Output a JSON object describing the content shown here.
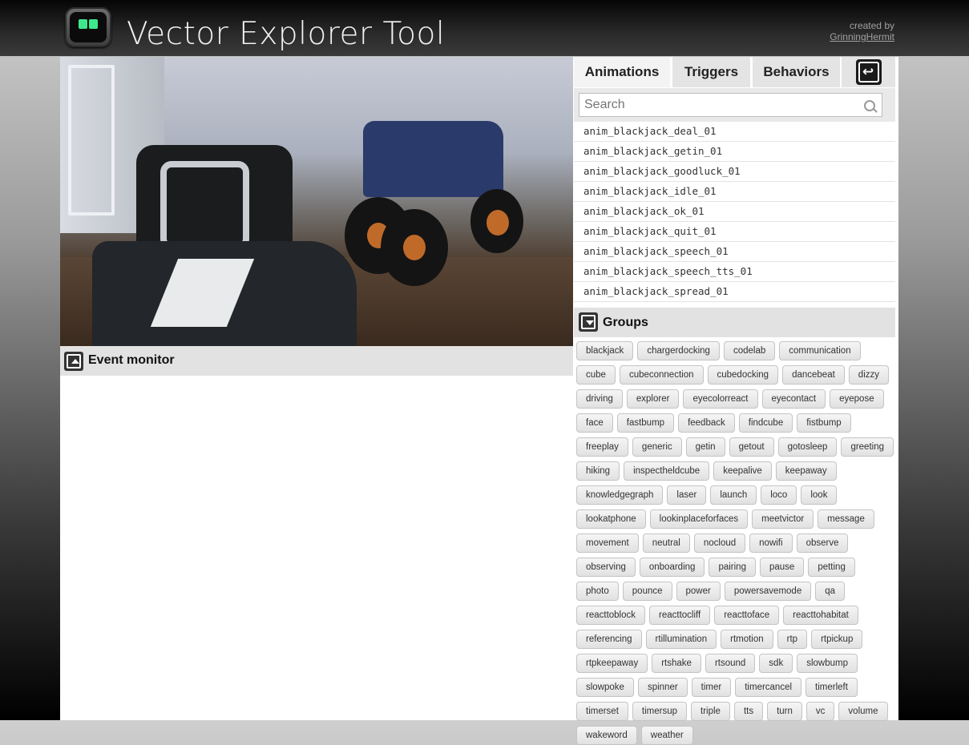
{
  "header": {
    "title": "Vector Explorer Tool",
    "created_by": "created by",
    "author": "GrinningHermit"
  },
  "event_monitor": {
    "title": "Event monitor"
  },
  "tabs": [
    {
      "label": "Animations"
    },
    {
      "label": "Triggers"
    },
    {
      "label": "Behaviors"
    }
  ],
  "search": {
    "placeholder": "Search",
    "value": ""
  },
  "animations": [
    "anim_blackjack_deal_01",
    "anim_blackjack_getin_01",
    "anim_blackjack_goodluck_01",
    "anim_blackjack_idle_01",
    "anim_blackjack_ok_01",
    "anim_blackjack_quit_01",
    "anim_blackjack_speech_01",
    "anim_blackjack_speech_tts_01",
    "anim_blackjack_spread_01"
  ],
  "groups": {
    "title": "Groups",
    "items": [
      "blackjack",
      "chargerdocking",
      "codelab",
      "communication",
      "cube",
      "cubeconnection",
      "cubedocking",
      "dancebeat",
      "dizzy",
      "driving",
      "explorer",
      "eyecolorreact",
      "eyecontact",
      "eyepose",
      "face",
      "fastbump",
      "feedback",
      "findcube",
      "fistbump",
      "freeplay",
      "generic",
      "getin",
      "getout",
      "gotosleep",
      "greeting",
      "hiking",
      "inspectheldcube",
      "keepalive",
      "keepaway",
      "knowledgegraph",
      "laser",
      "launch",
      "loco",
      "look",
      "lookatphone",
      "lookinplaceforfaces",
      "meetvictor",
      "message",
      "movement",
      "neutral",
      "nocloud",
      "nowifi",
      "observe",
      "observing",
      "onboarding",
      "pairing",
      "pause",
      "petting",
      "photo",
      "pounce",
      "power",
      "powersavemode",
      "qa",
      "reacttoblock",
      "reacttocliff",
      "reacttoface",
      "reacttohabitat",
      "referencing",
      "rtillumination",
      "rtmotion",
      "rtp",
      "rtpickup",
      "rtpkeepaway",
      "rtshake",
      "rtsound",
      "sdk",
      "slowbump",
      "slowpoke",
      "spinner",
      "timer",
      "timercancel",
      "timerleft",
      "timerset",
      "timersup",
      "triple",
      "tts",
      "turn",
      "vc",
      "volume",
      "wakeword",
      "weather"
    ]
  },
  "colors": {
    "logo_eye": "#3fe88c",
    "panel_bar": "#e2e2e2"
  }
}
